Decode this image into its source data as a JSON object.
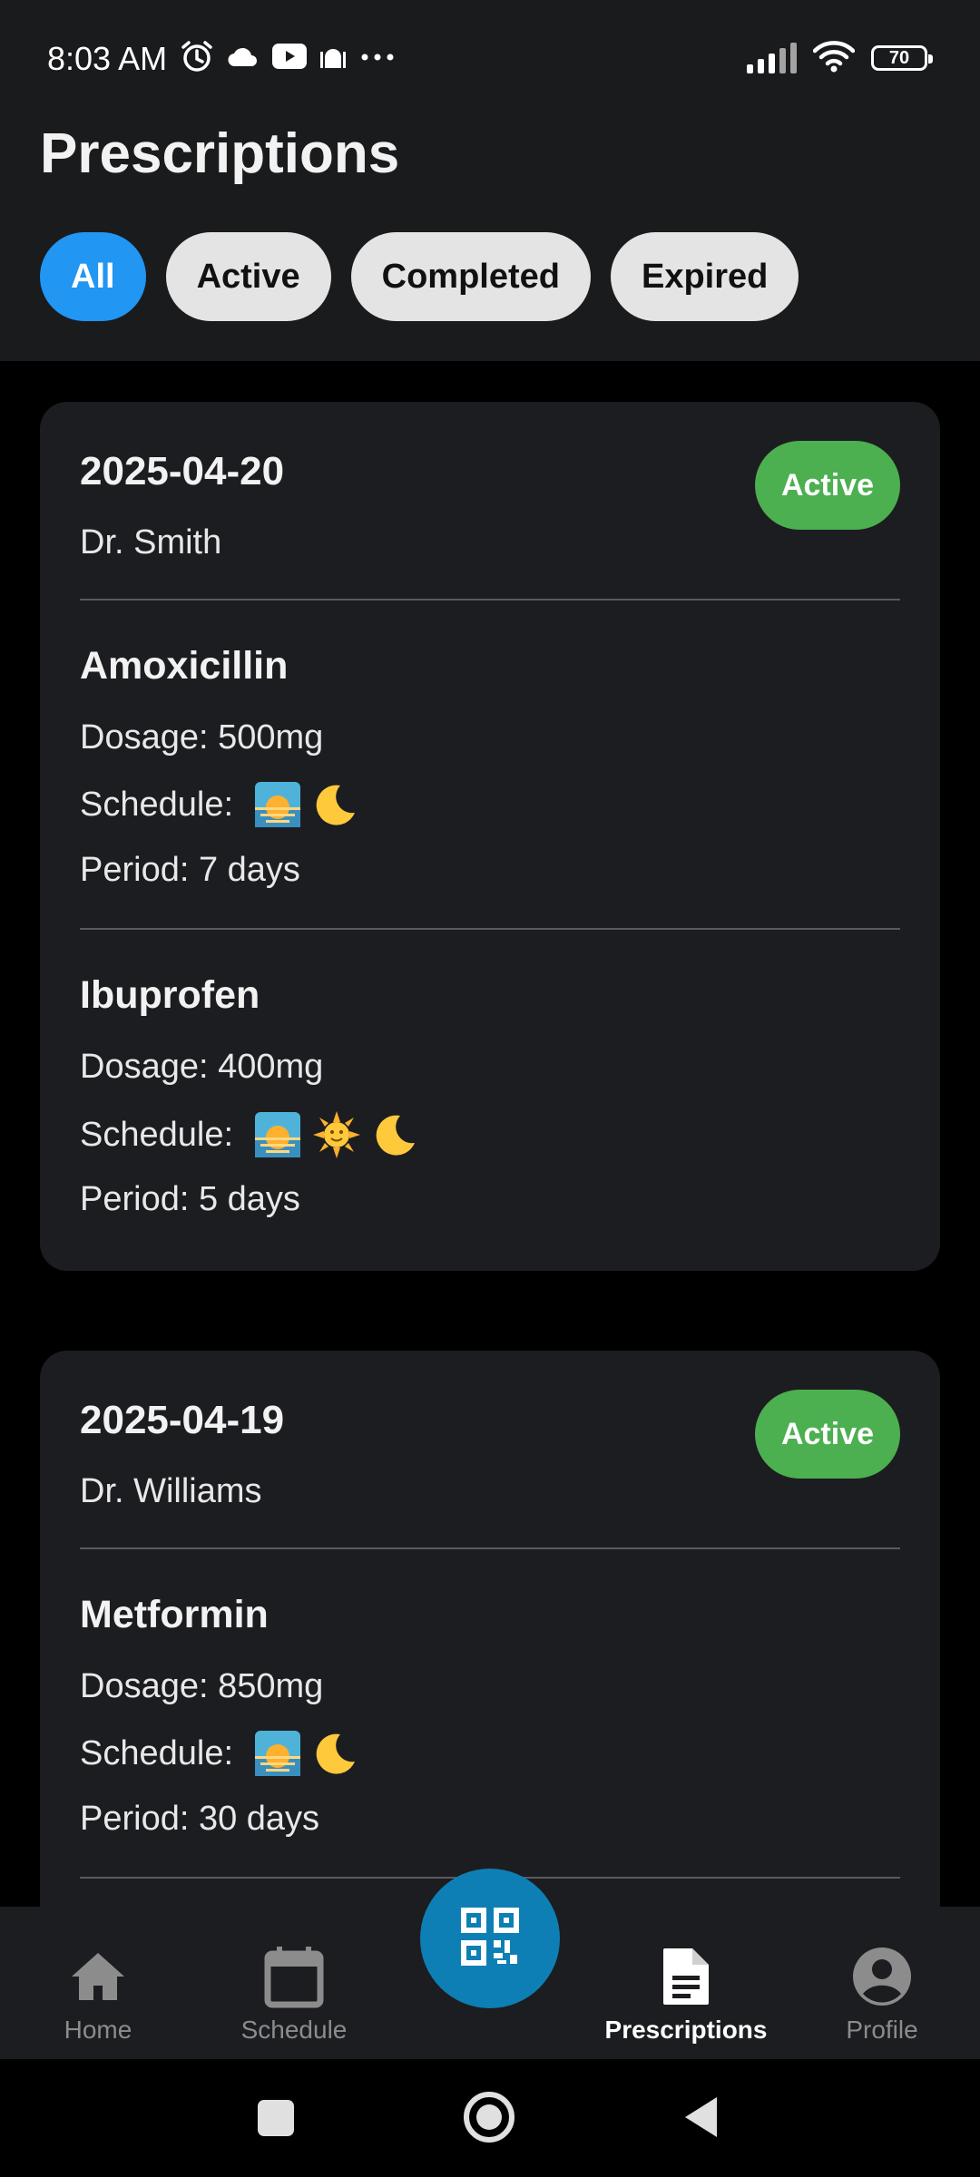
{
  "status_bar": {
    "time": "8:03 AM",
    "battery": "70",
    "icons_left": [
      "alarm-icon",
      "cloud-icon",
      "youtube-icon",
      "mosque-icon",
      "more-icon"
    ],
    "icons_right": [
      "signal-icon",
      "wifi-icon",
      "battery-icon"
    ]
  },
  "page": {
    "title": "Prescriptions"
  },
  "filters": [
    {
      "label": "All",
      "selected": true
    },
    {
      "label": "Active",
      "selected": false
    },
    {
      "label": "Completed",
      "selected": false
    },
    {
      "label": "Expired",
      "selected": false
    }
  ],
  "prescriptions": [
    {
      "date": "2025-04-20",
      "doctor": "Dr. Smith",
      "status": "Active",
      "medications": [
        {
          "name": "Amoxicillin",
          "dosage": "Dosage: 500mg",
          "schedule_label": "Schedule:",
          "schedule": [
            "sunrise",
            "moon"
          ],
          "period": "Period: 7 days"
        },
        {
          "name": "Ibuprofen",
          "dosage": "Dosage: 400mg",
          "schedule_label": "Schedule:",
          "schedule": [
            "sunrise",
            "sun",
            "moon"
          ],
          "period": "Period: 5 days"
        }
      ]
    },
    {
      "date": "2025-04-19",
      "doctor": "Dr. Williams",
      "status": "Active",
      "medications": [
        {
          "name": "Metformin",
          "dosage": "Dosage: 850mg",
          "schedule_label": "Schedule:",
          "schedule": [
            "sunrise",
            "moon"
          ],
          "period": "Period: 30 days"
        }
      ]
    }
  ],
  "bottom_nav": {
    "items": [
      {
        "label": "Home",
        "icon": "home-icon"
      },
      {
        "label": "Schedule",
        "icon": "calendar-icon"
      },
      {
        "label": "Prescriptions",
        "icon": "document-icon",
        "current": true
      },
      {
        "label": "Profile",
        "icon": "profile-icon"
      }
    ],
    "fab_icon": "qr-code-icon"
  },
  "colors": {
    "header_bg": "#1a1b1d",
    "card_bg": "#1c1d20",
    "accent_blue": "#2196f3",
    "active_green": "#4caf50",
    "fab": "#0e7fb5"
  }
}
